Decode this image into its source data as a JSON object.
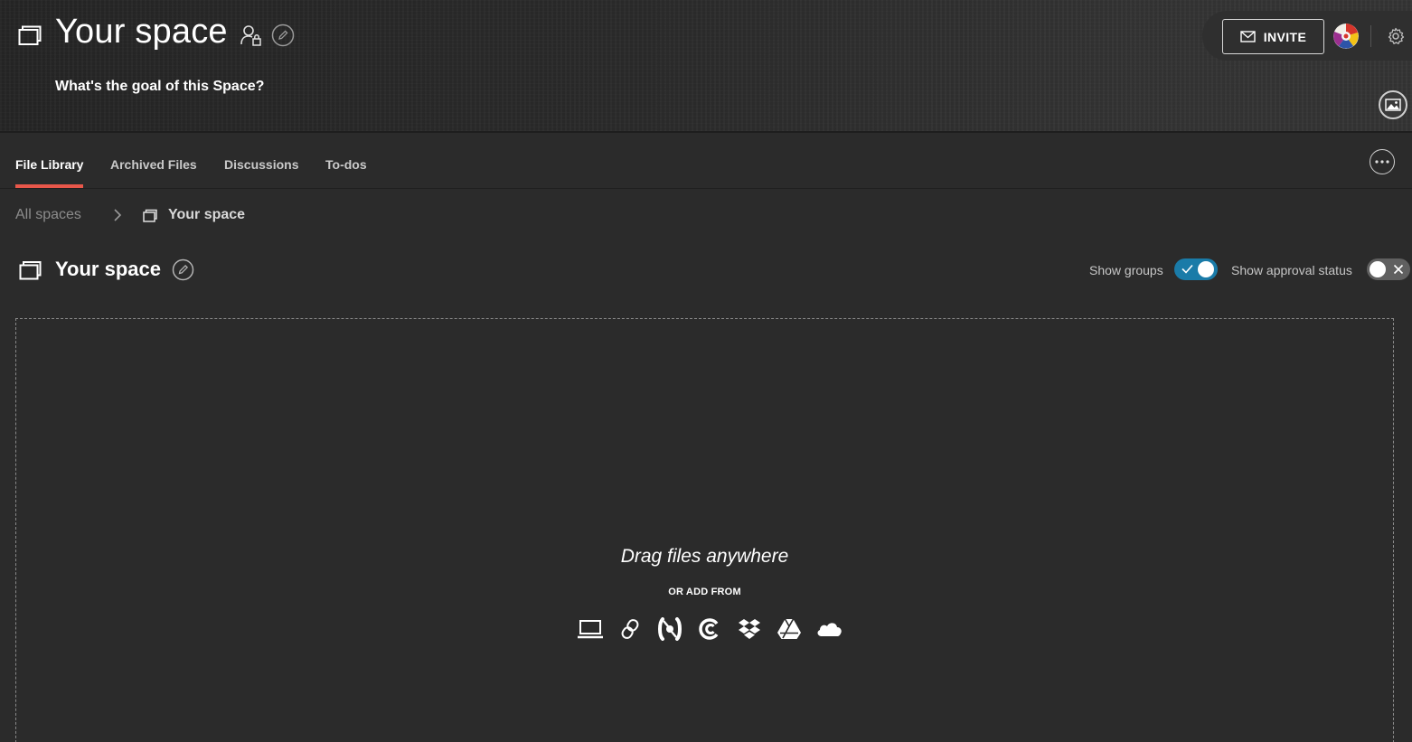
{
  "header": {
    "title": "Your space",
    "goal_placeholder": "What's the goal of this Space?",
    "invite_label": "INVITE",
    "icons": [
      "space-icon",
      "private-user-icon",
      "pencil-icon",
      "mail-icon",
      "avatar",
      "gear-icon",
      "image-icon"
    ]
  },
  "tabs": [
    {
      "label": "File Library",
      "active": true
    },
    {
      "label": "Archived Files",
      "active": false
    },
    {
      "label": "Discussions",
      "active": false
    },
    {
      "label": "To-dos",
      "active": false
    }
  ],
  "breadcrumb": {
    "root": "All spaces",
    "current": "Your space"
  },
  "section": {
    "title": "Your space",
    "show_groups_label": "Show groups",
    "show_groups_on": true,
    "show_approval_label": "Show approval status",
    "show_approval_on": false
  },
  "dropzone": {
    "title": "Drag files anywhere",
    "subtitle": "OR ADD FROM",
    "sources": [
      "computer-icon",
      "link-icon",
      "frameio-icon",
      "creative-cloud-icon",
      "dropbox-icon",
      "google-drive-icon",
      "onedrive-icon"
    ]
  },
  "colors": {
    "background": "#2b2b2b",
    "accent_tab": "#e8574a",
    "toggle_on": "#1a7ba8",
    "toggle_off": "#606060"
  }
}
